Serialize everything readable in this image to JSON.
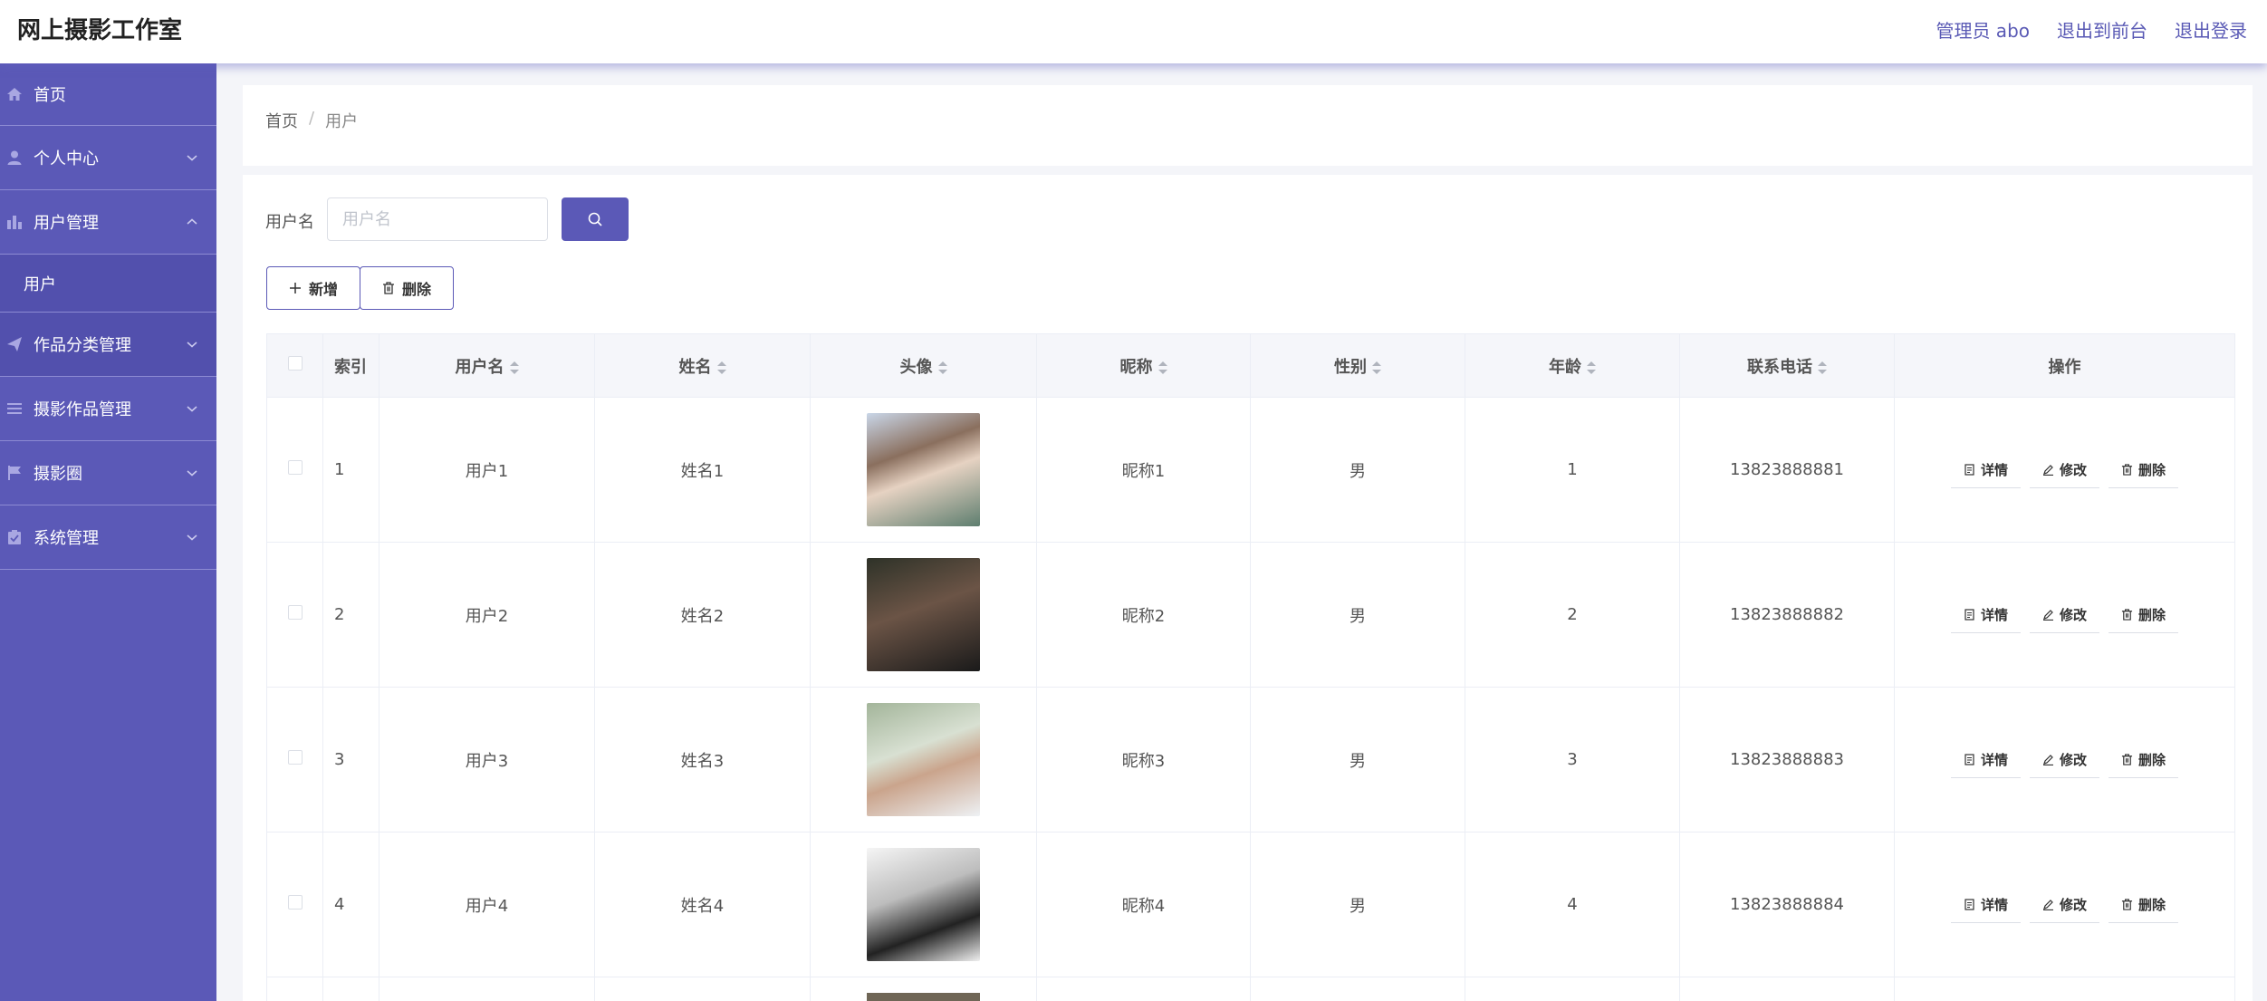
{
  "header": {
    "title": "网上摄影工作室",
    "admin_label": "管理员 abo",
    "front_label": "退出到前台",
    "logout_label": "退出登录"
  },
  "sidebar": {
    "items": [
      {
        "label": "首页",
        "icon": "home-icon"
      },
      {
        "label": "个人中心",
        "icon": "user-icon"
      },
      {
        "label": "用户管理",
        "icon": "bar-chart-icon",
        "expanded": true
      },
      {
        "label": "作品分类管理",
        "icon": "send-icon"
      },
      {
        "label": "摄影作品管理",
        "icon": "menu-icon"
      },
      {
        "label": "摄影圈",
        "icon": "flag-icon"
      },
      {
        "label": "系统管理",
        "icon": "clipboard-icon"
      }
    ],
    "submenu_label": "用户"
  },
  "breadcrumb": {
    "home": "首页",
    "separator": "/",
    "current": "用户"
  },
  "search": {
    "label": "用户名",
    "placeholder": "用户名"
  },
  "toolbar": {
    "add_label": "新增",
    "delete_label": "删除"
  },
  "table": {
    "headers": {
      "index": "索引",
      "username": "用户名",
      "name": "姓名",
      "avatar": "头像",
      "nickname": "昵称",
      "gender": "性别",
      "age": "年龄",
      "phone": "联系电话",
      "actions": "操作"
    },
    "rows": [
      {
        "index": "1",
        "username": "用户1",
        "name": "姓名1",
        "nickname": "昵称1",
        "gender": "男",
        "age": "1",
        "phone": "13823888881"
      },
      {
        "index": "2",
        "username": "用户2",
        "name": "姓名2",
        "nickname": "昵称2",
        "gender": "男",
        "age": "2",
        "phone": "13823888882"
      },
      {
        "index": "3",
        "username": "用户3",
        "name": "姓名3",
        "nickname": "昵称3",
        "gender": "男",
        "age": "3",
        "phone": "13823888883"
      },
      {
        "index": "4",
        "username": "用户4",
        "name": "姓名4",
        "nickname": "昵称4",
        "gender": "男",
        "age": "4",
        "phone": "13823888884"
      }
    ],
    "action_labels": {
      "detail": "详情",
      "edit": "修改",
      "delete": "删除"
    }
  },
  "colors": {
    "accent": "#5b59b7",
    "sidebar_bg": "#5b59b7",
    "link": "#5a5ab5"
  }
}
